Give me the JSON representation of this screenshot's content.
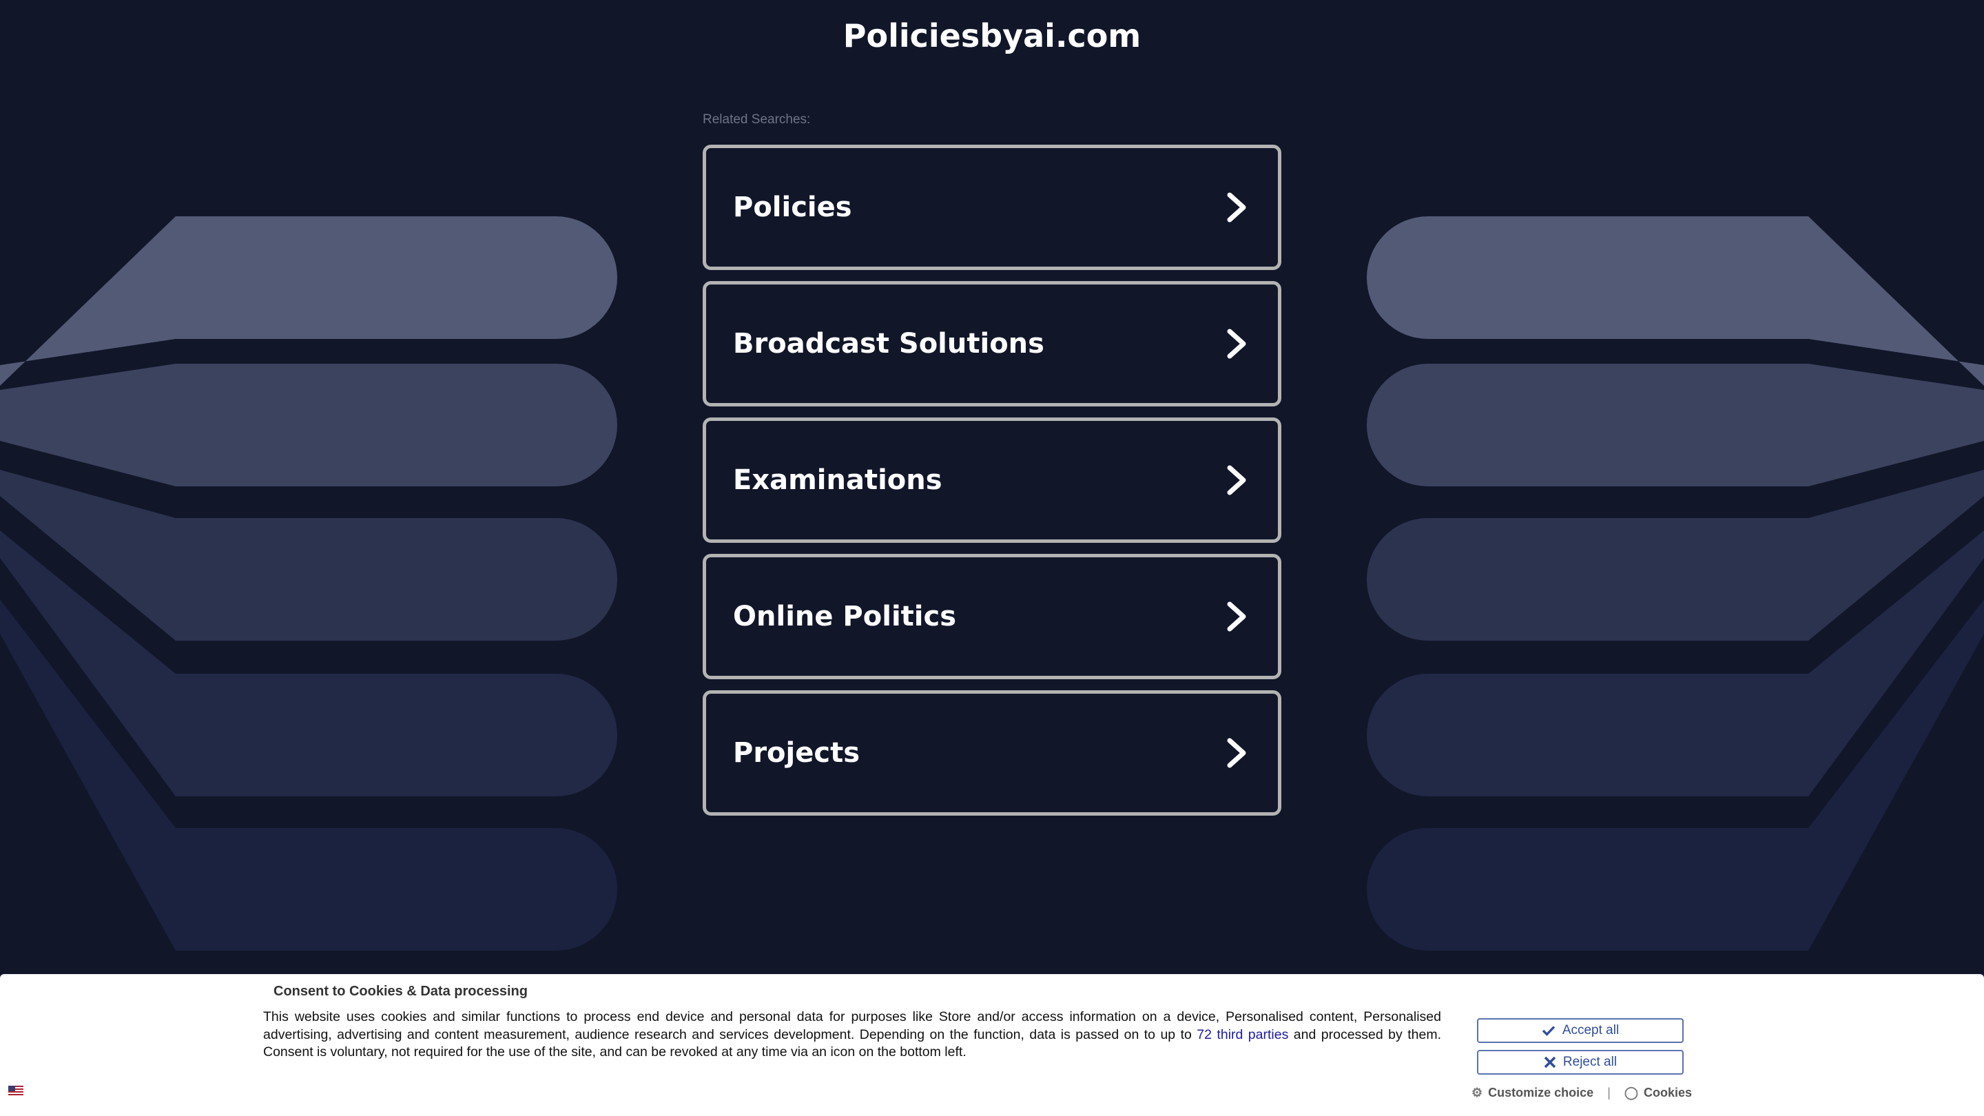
{
  "header": {
    "site_title": "Policiesbyai.com"
  },
  "related": {
    "label": "Related Searches:",
    "items": [
      {
        "label": "Policies"
      },
      {
        "label": "Broadcast Solutions"
      },
      {
        "label": "Examinations"
      },
      {
        "label": "Online Politics"
      },
      {
        "label": "Projects"
      }
    ]
  },
  "consent": {
    "title": "Consent to Cookies & Data processing",
    "text_before": "This website uses cookies and similar functions to process end device and personal data for purposes like Store and/or access information on a device, Personalised content, Personalised advertising, advertising and content measurement, audience research and services development. Depending on the function, data is passed on to up to ",
    "link_text": "72 third parties",
    "text_after": " and processed by them. Consent is voluntary, not required for the use of the site, and can be revoked at any time via an icon on the bottom left.",
    "accept_label": "Accept all",
    "reject_label": "Reject all",
    "customize_label": "Customize choice",
    "separator": "|",
    "cookies_label": "Cookies"
  },
  "colors": {
    "background": "#111629",
    "tile_border": "#b3b3b3",
    "button_text": "#2f4f9a",
    "link": "#1a1aa6"
  },
  "icons": {
    "tile_arrow": "chevron-right-icon",
    "accept": "check-icon",
    "reject": "close-icon",
    "customize": "gear-icon",
    "cookies": "cookie-icon",
    "language": "flag-icon"
  }
}
